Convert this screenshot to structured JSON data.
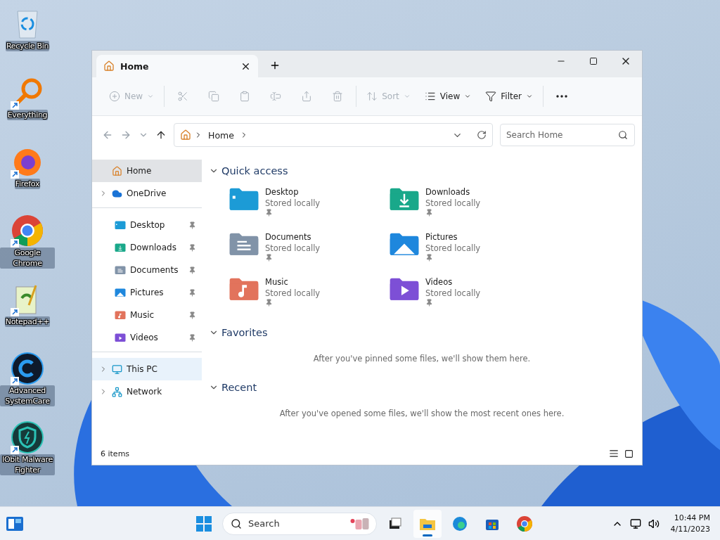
{
  "desktop_icons": [
    {
      "label": "Recycle Bin",
      "kind": "bin",
      "shortcut": false
    },
    {
      "label": "Everything",
      "kind": "loupe",
      "shortcut": true
    },
    {
      "label": "Firefox",
      "kind": "fox",
      "shortcut": true
    },
    {
      "label": "Google Chrome",
      "kind": "chrome",
      "shortcut": true
    },
    {
      "label": "Notepad++",
      "kind": "notepad",
      "shortcut": true
    },
    {
      "label": "Advanced SystemCare",
      "kind": "care",
      "shortcut": true
    },
    {
      "label": "IObit Malware Fighter",
      "kind": "shield",
      "shortcut": true
    }
  ],
  "window": {
    "tabs": [
      {
        "label": "Home",
        "selected": true
      }
    ],
    "toolbar": [
      [
        {
          "kind": "new",
          "label": "New",
          "disabled": true,
          "dropdown": true
        }
      ],
      [
        {
          "kind": "cut",
          "disabled": true
        },
        {
          "kind": "copy",
          "disabled": true
        },
        {
          "kind": "paste",
          "disabled": true
        },
        {
          "kind": "rename",
          "disabled": true
        },
        {
          "kind": "share",
          "disabled": true
        },
        {
          "kind": "delete",
          "disabled": true
        }
      ],
      [
        {
          "kind": "sort",
          "label": "Sort",
          "disabled": true,
          "dropdown": true
        },
        {
          "kind": "view",
          "label": "View",
          "disabled": false,
          "dropdown": true
        },
        {
          "kind": "filter",
          "label": "Filter",
          "disabled": false,
          "dropdown": true
        }
      ],
      [
        {
          "kind": "more",
          "disabled": false
        }
      ]
    ],
    "address": {
      "crumbs": [
        "Home"
      ]
    },
    "search": {
      "placeholder": "Search Home"
    },
    "sidebar": [
      [
        {
          "label": "Home",
          "kind": "home",
          "selected": true,
          "hovered": false,
          "expandable": false,
          "pinned": false
        },
        {
          "label": "OneDrive",
          "kind": "cloud",
          "selected": false,
          "hovered": false,
          "expandable": true,
          "pinned": false
        }
      ],
      [
        {
          "label": "Desktop",
          "kind": "desktop",
          "selected": false,
          "hovered": false,
          "expandable": false,
          "pinned": true
        },
        {
          "label": "Downloads",
          "kind": "downloads",
          "selected": false,
          "hovered": false,
          "expandable": false,
          "pinned": true
        },
        {
          "label": "Documents",
          "kind": "documents",
          "selected": false,
          "hovered": false,
          "expandable": false,
          "pinned": true
        },
        {
          "label": "Pictures",
          "kind": "pictures",
          "selected": false,
          "hovered": false,
          "expandable": false,
          "pinned": true
        },
        {
          "label": "Music",
          "kind": "music",
          "selected": false,
          "hovered": false,
          "expandable": false,
          "pinned": true
        },
        {
          "label": "Videos",
          "kind": "videos",
          "selected": false,
          "hovered": false,
          "expandable": false,
          "pinned": true
        }
      ],
      [
        {
          "label": "This PC",
          "kind": "pc",
          "selected": false,
          "hovered": true,
          "expandable": true,
          "pinned": false
        },
        {
          "label": "Network",
          "kind": "network",
          "selected": false,
          "hovered": false,
          "expandable": true,
          "pinned": false
        }
      ]
    ],
    "sections": [
      {
        "title": "Quick access",
        "expanded": true,
        "items": [
          {
            "name": "Desktop",
            "kind": "desktop",
            "status": "Stored locally",
            "pinned": true
          },
          {
            "name": "Downloads",
            "kind": "downloads",
            "status": "Stored locally",
            "pinned": true
          },
          {
            "name": "Documents",
            "kind": "documents",
            "status": "Stored locally",
            "pinned": true
          },
          {
            "name": "Pictures",
            "kind": "pictures",
            "status": "Stored locally",
            "pinned": true
          },
          {
            "name": "Music",
            "kind": "music",
            "status": "Stored locally",
            "pinned": true
          },
          {
            "name": "Videos",
            "kind": "videos",
            "status": "Stored locally",
            "pinned": true
          }
        ]
      },
      {
        "title": "Favorites",
        "expanded": true,
        "message": "After you've pinned some files, we'll show them here."
      },
      {
        "title": "Recent",
        "expanded": true,
        "message": "After you've opened some files, we'll show the most recent ones here."
      }
    ],
    "status_bar": {
      "count": "6 items"
    }
  },
  "taskbar": {
    "search": {
      "placeholder": "Search"
    },
    "apps": [
      {
        "kind": "tasks",
        "active": false
      },
      {
        "kind": "explorer",
        "active": true
      },
      {
        "kind": "edge",
        "active": false
      },
      {
        "kind": "store",
        "active": false
      },
      {
        "kind": "chrome",
        "active": false
      }
    ],
    "time": "10:44 PM",
    "date": "4/11/2023"
  }
}
